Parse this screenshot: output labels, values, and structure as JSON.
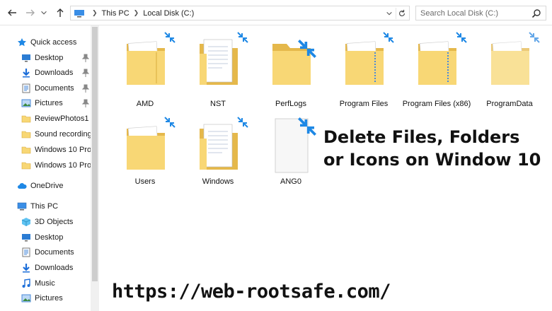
{
  "address_bar": {
    "crumbs": [
      "This PC",
      "Local Disk (C:)"
    ]
  },
  "search": {
    "placeholder": "Search Local Disk (C:)"
  },
  "sidebar": {
    "items": [
      {
        "label": "Quick access",
        "icon": "star-icon",
        "pinned": false
      },
      {
        "label": "Desktop",
        "icon": "desktop-icon",
        "pinned": true
      },
      {
        "label": "Downloads",
        "icon": "download-icon",
        "pinned": true
      },
      {
        "label": "Documents",
        "icon": "documents-icon",
        "pinned": true
      },
      {
        "label": "Pictures",
        "icon": "pictures-icon",
        "pinned": true
      },
      {
        "label": "ReviewPhotos1",
        "icon": "folder-icon",
        "pinned": false
      },
      {
        "label": "Sound recordings",
        "icon": "folder-icon",
        "pinned": false
      },
      {
        "label": "Windows 10 Pro",
        "icon": "folder-icon",
        "pinned": false
      },
      {
        "label": "Windows 10 Pro",
        "icon": "folder-icon",
        "pinned": false
      },
      {
        "label": "OneDrive",
        "icon": "cloud-icon",
        "pinned": false
      },
      {
        "label": "This PC",
        "icon": "computer-icon",
        "pinned": false
      },
      {
        "label": "3D Objects",
        "icon": "cube-icon",
        "pinned": false
      },
      {
        "label": "Desktop",
        "icon": "desktop-icon",
        "pinned": false
      },
      {
        "label": "Documents",
        "icon": "documents-icon",
        "pinned": false
      },
      {
        "label": "Downloads",
        "icon": "download-icon",
        "pinned": false
      },
      {
        "label": "Music",
        "icon": "music-icon",
        "pinned": false
      },
      {
        "label": "Pictures",
        "icon": "pictures-icon",
        "pinned": false
      }
    ]
  },
  "files": [
    {
      "name": "AMD",
      "type": "folder"
    },
    {
      "name": "NST",
      "type": "folder-docs"
    },
    {
      "name": "PerfLogs",
      "type": "folder-empty"
    },
    {
      "name": "Program Files",
      "type": "folder"
    },
    {
      "name": "Program Files (x86)",
      "type": "folder"
    },
    {
      "name": "ProgramData",
      "type": "folder"
    },
    {
      "name": "Users",
      "type": "folder"
    },
    {
      "name": "Windows",
      "type": "folder-docs"
    },
    {
      "name": "ANG0",
      "type": "file"
    }
  ],
  "overlay": {
    "headline": "Delete Files, Folders or Icons on Window 10",
    "url": "https://web-rootsafe.com/"
  },
  "colors": {
    "folder": "#f8d775",
    "folder_dark": "#e5b84b",
    "sync_arrow": "#1e88e5",
    "selection": "#cce8ff"
  }
}
